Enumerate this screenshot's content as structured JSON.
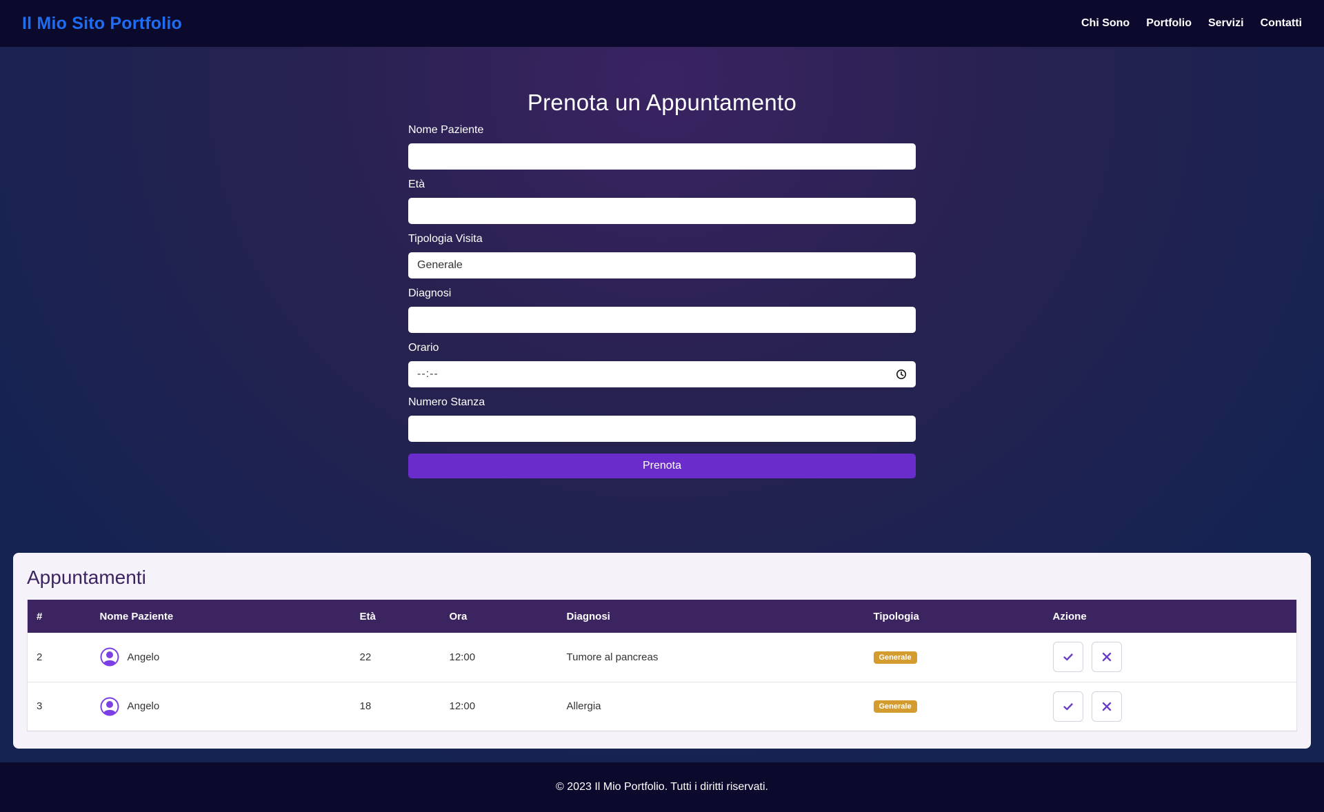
{
  "header": {
    "brand": "Il Mio Sito Portfolio",
    "nav": [
      "Chi Sono",
      "Portfolio",
      "Servizi",
      "Contatti"
    ]
  },
  "form": {
    "title": "Prenota un Appuntamento",
    "fields": {
      "nome_label": "Nome Paziente",
      "nome_value": "",
      "eta_label": "Età",
      "eta_value": "",
      "tipologia_label": "Tipologia Visita",
      "tipologia_value": "Generale",
      "diagnosi_label": "Diagnosi",
      "diagnosi_value": "",
      "orario_label": "Orario",
      "orario_value": "--:--",
      "stanza_label": "Numero Stanza",
      "stanza_value": ""
    },
    "submit_label": "Prenota"
  },
  "appointments": {
    "title": "Appuntamenti",
    "columns": [
      "#",
      "Nome Paziente",
      "Età",
      "Ora",
      "Diagnosi",
      "Tipologia",
      "Azione"
    ],
    "rows": [
      {
        "id": "2",
        "name": "Angelo",
        "age": "22",
        "time": "12:00",
        "diagnosis": "Tumore al pancreas",
        "type": "Generale"
      },
      {
        "id": "3",
        "name": "Angelo",
        "age": "18",
        "time": "12:00",
        "diagnosis": "Allergia",
        "type": "Generale"
      }
    ]
  },
  "footer": {
    "text": "© 2023 Il Mio Portfolio. Tutti i diritti riservati."
  },
  "colors": {
    "brand": "#1e6df2",
    "header_bg": "#0b0a2c",
    "button": "#6a2ccb",
    "table_header": "#3b2460",
    "badge": "#d49c2f",
    "icon_accent": "#7b3fe4"
  }
}
